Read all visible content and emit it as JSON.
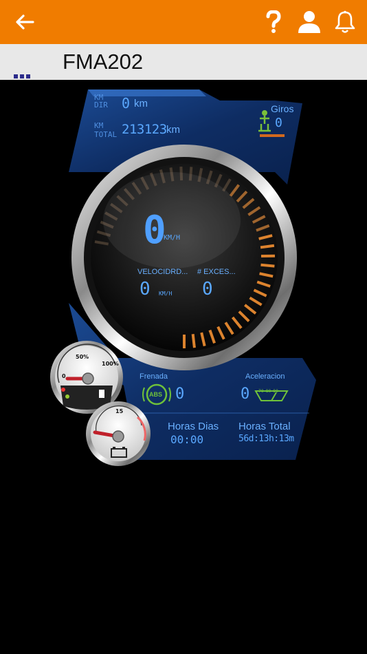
{
  "topbar": {
    "back_icon": "arrow-left-icon",
    "help_icon": "question-icon",
    "user_icon": "user-icon",
    "bell_icon": "bell-icon",
    "color": "#f07c00"
  },
  "header": {
    "title": "FMA202",
    "menu_icon": "dots-icon"
  },
  "odometer": {
    "km_dir_label_1": "KM",
    "km_dir_label_2": "DIR",
    "km_dir_value": "0",
    "km_dir_unit": "km",
    "km_total_label_1": "KM",
    "km_total_label_2": "TOTAL",
    "km_total_value": "213123",
    "km_total_unit": "km"
  },
  "giros": {
    "label": "Giros",
    "value": "0"
  },
  "speedometer": {
    "speed": "0",
    "speed_unit": "KM/H",
    "velocidad_label": "VELOCIDRD...",
    "velocidad_value": "0",
    "velocidad_unit": "KM/H",
    "exceso_label": "# EXCES...",
    "exceso_value": "0"
  },
  "frenada": {
    "label": "Frenada",
    "icon_text": "ABS",
    "value": "0"
  },
  "aceleracion": {
    "label": "Aceleracion",
    "value": "0",
    "gauge_ticks": [
      "70",
      "80",
      "90"
    ]
  },
  "fuel_gauge": {
    "tick_0": "0",
    "tick_50": "50%",
    "tick_100": "100%"
  },
  "battery_gauge": {
    "tick": "15"
  },
  "horas": {
    "dias_label": "Horas Dias",
    "dias_value": "00:00",
    "total_label": "Horas Total",
    "total_value": "56d:13h:13m"
  }
}
